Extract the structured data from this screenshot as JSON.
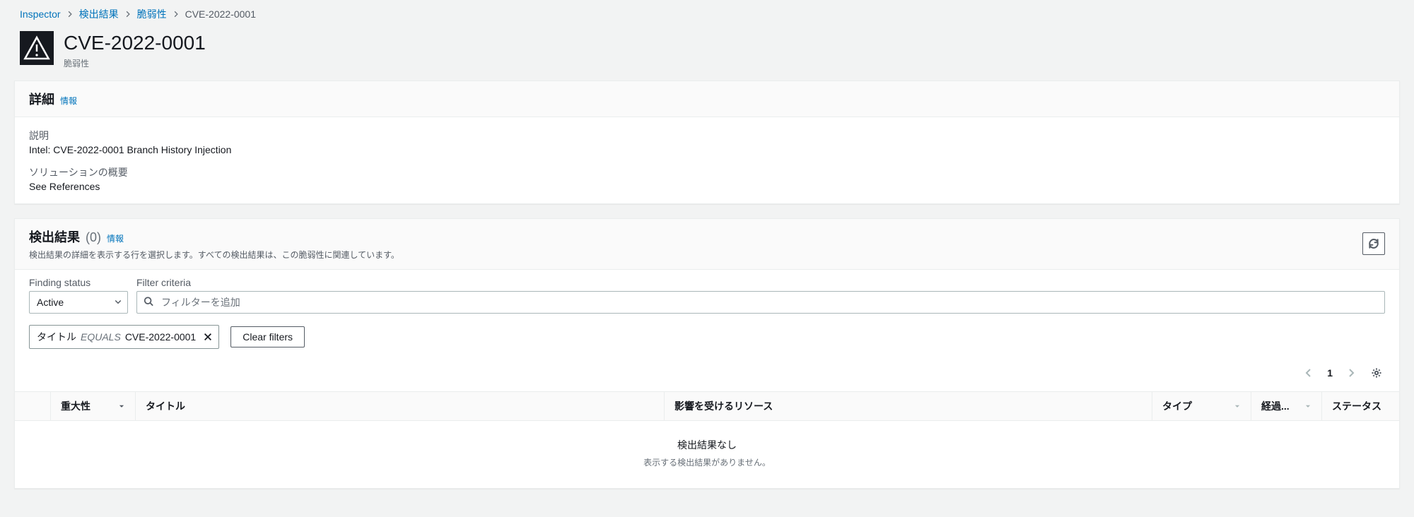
{
  "breadcrumb": {
    "items": [
      "Inspector",
      "検出結果",
      "脆弱性"
    ],
    "current": "CVE-2022-0001"
  },
  "header": {
    "title": "CVE-2022-0001",
    "subtitle": "脆弱性"
  },
  "detail_panel": {
    "title": "詳細",
    "info_link": "情報",
    "description_label": "説明",
    "description_value": "Intel: CVE-2022-0001 Branch History Injection",
    "solution_label": "ソリューションの概要",
    "solution_value": "See References"
  },
  "findings_panel": {
    "title": "検出結果",
    "count": "(0)",
    "info_link": "情報",
    "description": "検出結果の詳細を表示する行を選択します。すべての検出結果は、この脆弱性に関連しています。",
    "finding_status_label": "Finding status",
    "finding_status_value": "Active",
    "filter_criteria_label": "Filter criteria",
    "filter_placeholder": "フィルターを追加",
    "chip": {
      "key": "タイトル",
      "op": "EQUALS",
      "value": "CVE-2022-0001"
    },
    "clear_filters": "Clear filters",
    "page": "1",
    "columns": {
      "severity": "重大性",
      "title": "タイトル",
      "resource": "影響を受けるリソース",
      "type": "タイプ",
      "age": "経過...",
      "status": "ステータス"
    },
    "empty_title": "検出結果なし",
    "empty_desc": "表示する検出結果がありません。"
  }
}
